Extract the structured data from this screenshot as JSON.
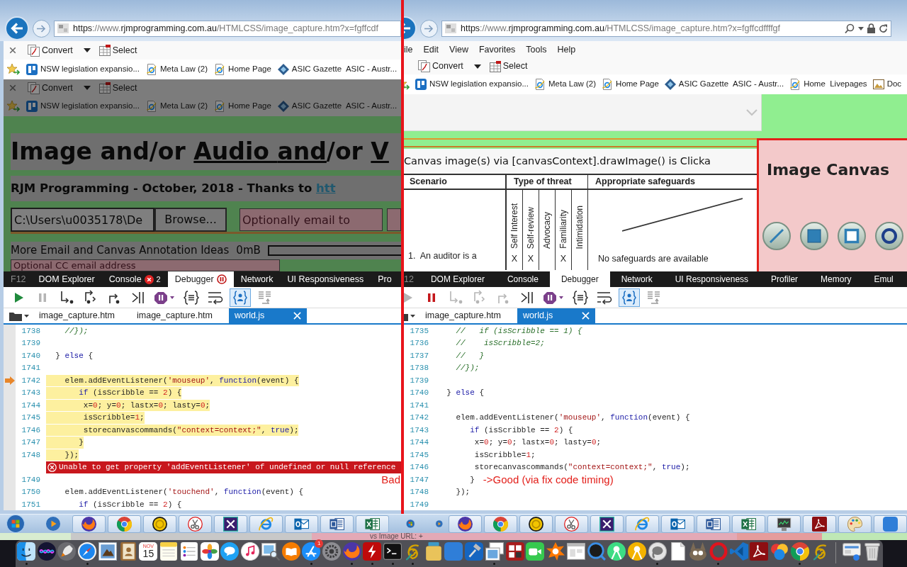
{
  "left_window": {
    "address_bar": {
      "url": [
        {
          "text": "https",
          "strong": true
        },
        {
          "text": "://www.",
          "strong": false
        },
        {
          "text": "rjmprogramming.com.au",
          "strong": true
        },
        {
          "text": "/HTMLCSS/image_capture.htm?x=fgffcdf",
          "strong": false
        }
      ]
    },
    "command_bar": {
      "items": [
        {
          "label": "Convert",
          "kind": "convert"
        },
        {
          "label": "Select",
          "kind": "select"
        }
      ]
    },
    "favorites": [
      {
        "label": "NSW legislation expansio...",
        "kind": "tile"
      },
      {
        "label": "Meta Law (2)",
        "kind": "page"
      },
      {
        "label": "Home Page",
        "kind": "page"
      },
      {
        "label": "ASIC Gazette  ASIC - Austr...",
        "kind": "diamond"
      }
    ],
    "page": {
      "dimmed": true,
      "command_bar": {
        "items": [
          {
            "label": "Convert",
            "kind": "convert"
          },
          {
            "label": "Select",
            "kind": "select"
          }
        ]
      },
      "favorites": [
        {
          "label": "NSW legislation expansio...",
          "kind": "tile"
        },
        {
          "label": "Meta Law (2)",
          "kind": "page"
        },
        {
          "label": "Home Page",
          "kind": "page"
        },
        {
          "label": "ASIC Gazette  ASIC - Austr...",
          "kind": "diamond"
        }
      ],
      "heading": [
        {
          "text": "Image and/or ",
          "link": false
        },
        {
          "text": "Audio ",
          "link": true
        },
        {
          "text": "and",
          "link": true
        },
        {
          "text": "/or ",
          "link": false
        },
        {
          "text": "V",
          "link": true
        }
      ],
      "subheading": [
        {
          "text": "RJM Programming - October, 2018 - Thanks to ",
          "link": false
        },
        {
          "text": "htt",
          "link": true
        }
      ],
      "file_field": {
        "value": "C:\\Users\\u0035178\\De"
      },
      "browse_button": "Browse...",
      "email_field": {
        "placeholder": "Optionally email to"
      },
      "ideas_label": "More Email and Canvas Annotation Ideas",
      "size_reading": "0mB",
      "cc_field": {
        "placeholder": "Optional CC email address"
      }
    },
    "devtools": {
      "f12_label": "F12",
      "tabs": [
        {
          "label": "DOM Explorer",
          "selected": false
        },
        {
          "label": "Console",
          "selected": false,
          "count": "2"
        },
        {
          "label": "Debugger",
          "selected": true,
          "paused": true
        },
        {
          "label": "Network",
          "selected": false
        },
        {
          "label": "UI Responsiveness",
          "selected": false
        },
        {
          "label": "Pro",
          "selected": false
        }
      ],
      "toolbar": {
        "paused": true,
        "just_my_code": true
      },
      "files": [
        {
          "label": "image_capture.htm",
          "selected": false
        },
        {
          "label": "image_capture.htm",
          "selected": false
        },
        {
          "label": "world.js",
          "selected": true
        }
      ],
      "lines": [
        {
          "kind": "code",
          "number": "1738",
          "highlighted": false,
          "current": false,
          "tokens": [
            {
              "text": "    //});",
              "kind": "comment"
            }
          ]
        },
        {
          "kind": "code",
          "number": "1739",
          "current": false
        },
        {
          "kind": "code",
          "number": "1740",
          "highlighted": false,
          "current": false,
          "tokens": [
            {
              "text": "  } ",
              "kind": "plain"
            },
            {
              "text": "else",
              "kind": "keyword"
            },
            {
              "text": " {",
              "kind": "plain"
            }
          ]
        },
        {
          "kind": "code",
          "number": "1741",
          "current": false
        },
        {
          "kind": "code",
          "number": "1742",
          "highlighted": true,
          "current": true,
          "tokens": [
            {
              "text": "    elem.addEventListener(",
              "kind": "plain"
            },
            {
              "text": "'mouseup'",
              "kind": "string"
            },
            {
              "text": ", ",
              "kind": "plain"
            },
            {
              "text": "function",
              "kind": "keyword"
            },
            {
              "text": "(event) {",
              "kind": "plain"
            }
          ]
        },
        {
          "kind": "code",
          "number": "1743",
          "highlighted": true,
          "current": false,
          "tokens": [
            {
              "text": "       if",
              "kind": "keyword"
            },
            {
              "text": " (isScribble == ",
              "kind": "plain"
            },
            {
              "text": "2",
              "kind": "number"
            },
            {
              "text": ") {",
              "kind": "plain"
            }
          ]
        },
        {
          "kind": "code",
          "number": "1744",
          "highlighted": true,
          "current": false,
          "tokens": [
            {
              "text": "        x=",
              "kind": "plain"
            },
            {
              "text": "0",
              "kind": "number"
            },
            {
              "text": "; y=",
              "kind": "plain"
            },
            {
              "text": "0",
              "kind": "number"
            },
            {
              "text": "; lastx=",
              "kind": "plain"
            },
            {
              "text": "0",
              "kind": "number"
            },
            {
              "text": "; lasty=",
              "kind": "plain"
            },
            {
              "text": "0",
              "kind": "number"
            },
            {
              "text": ";",
              "kind": "plain"
            }
          ]
        },
        {
          "kind": "code",
          "number": "1745",
          "highlighted": true,
          "current": false,
          "tokens": [
            {
              "text": "        isScribble=",
              "kind": "plain"
            },
            {
              "text": "1",
              "kind": "number"
            },
            {
              "text": ";",
              "kind": "plain"
            }
          ]
        },
        {
          "kind": "code",
          "number": "1746",
          "highlighted": true,
          "current": false,
          "tokens": [
            {
              "text": "        storecanvascommands(",
              "kind": "plain"
            },
            {
              "text": "\"context=context;\"",
              "kind": "string"
            },
            {
              "text": ", ",
              "kind": "plain"
            },
            {
              "text": "true",
              "kind": "keyword"
            },
            {
              "text": ");",
              "kind": "plain"
            }
          ]
        },
        {
          "kind": "code",
          "number": "1747",
          "highlighted": true,
          "current": false,
          "tokens": [
            {
              "text": "       }",
              "kind": "plain"
            }
          ]
        },
        {
          "kind": "code",
          "number": "1748",
          "highlighted": true,
          "current": false,
          "tokens": [
            {
              "text": "    });",
              "kind": "plain"
            }
          ]
        },
        {
          "kind": "error",
          "message": "Unable to get property 'addEventListener' of undefined or null reference"
        },
        {
          "kind": "code",
          "number": "1749",
          "current": false,
          "note": {
            "text": "Bad",
            "kind": "margin"
          }
        },
        {
          "kind": "code",
          "number": "1750",
          "highlighted": false,
          "current": false,
          "tokens": [
            {
              "text": "    elem.addEventListener(",
              "kind": "plain"
            },
            {
              "text": "'touchend'",
              "kind": "string"
            },
            {
              "text": ", ",
              "kind": "plain"
            },
            {
              "text": "function",
              "kind": "keyword"
            },
            {
              "text": "(event) {",
              "kind": "plain"
            }
          ]
        },
        {
          "kind": "code",
          "number": "1751",
          "highlighted": false,
          "current": false,
          "tokens": [
            {
              "text": "       if",
              "kind": "keyword"
            },
            {
              "text": " (isScribble == ",
              "kind": "plain"
            },
            {
              "text": "2",
              "kind": "number"
            },
            {
              "text": ") {",
              "kind": "plain"
            }
          ]
        }
      ]
    }
  },
  "right_window": {
    "address_bar": {
      "url": [
        {
          "text": "https",
          "strong": true
        },
        {
          "text": "://www.",
          "strong": false
        },
        {
          "text": "rjmprogramming.com.au",
          "strong": true
        },
        {
          "text": "/HTMLCSS/image_capture.htm?x=fgffcdffffgf",
          "strong": false
        }
      ]
    },
    "menu_bar": [
      "ile",
      "Edit",
      "View",
      "Favorites",
      "Tools",
      "Help"
    ],
    "command_bar": {
      "items": [
        {
          "label": "Convert",
          "kind": "convert"
        },
        {
          "label": "Select",
          "kind": "select"
        }
      ]
    },
    "favorites": [
      {
        "label": "NSW legislation expansio...",
        "kind": "tile"
      },
      {
        "label": "Meta Law (2)",
        "kind": "page"
      },
      {
        "label": "Home Page",
        "kind": "page"
      },
      {
        "label": "ASIC Gazette  ASIC - Austr...",
        "kind": "diamond"
      },
      {
        "label": "Home  Livepages",
        "kind": "page"
      },
      {
        "label": "Doc",
        "kind": "picture"
      }
    ],
    "page": {
      "canvas_caption": "Canvas image(s) via [canvasContext].drawImage() is Clicka",
      "threat_table": {
        "headings": [
          "Scenario",
          "Type of threat",
          "Appropriate safeguards"
        ],
        "threat_columns": [
          {
            "heading": "Self Interest",
            "mark": "X"
          },
          {
            "heading": "Self-review",
            "mark": "X"
          },
          {
            "heading": "Advocacy"
          },
          {
            "heading": "Familiarity",
            "mark": "X"
          },
          {
            "heading": "Intimidation"
          }
        ],
        "scenario": "1.  An auditor is a",
        "safeguards": "No safeguards are available"
      },
      "canvas_panel": {
        "title": "Image Canvas",
        "tools": [
          {
            "kind": "line"
          },
          {
            "kind": "filled_square"
          },
          {
            "kind": "square"
          },
          {
            "kind": "circle"
          }
        ]
      }
    },
    "devtools": {
      "f12_label": "12",
      "tabs": [
        {
          "label": "DOM Explorer",
          "selected": false
        },
        {
          "label": "Console",
          "selected": false
        },
        {
          "label": "Debugger",
          "selected": true,
          "paused": false
        },
        {
          "label": "Network",
          "selected": false
        },
        {
          "label": "UI Responsiveness",
          "selected": false
        },
        {
          "label": "Profiler",
          "selected": false
        },
        {
          "label": "Memory",
          "selected": false
        },
        {
          "label": "Emul",
          "selected": false
        }
      ],
      "toolbar": {
        "paused": false,
        "just_my_code": true
      },
      "files": [
        {
          "label": "image_capture.htm",
          "selected": false
        },
        {
          "label": "world.js",
          "selected": true
        }
      ],
      "lines": [
        {
          "kind": "code",
          "number": "1735",
          "tokens": [
            {
              "text": "    //   if (isScribble == 1) {",
              "kind": "comment"
            }
          ]
        },
        {
          "kind": "code",
          "number": "1736",
          "tokens": [
            {
              "text": "    //    isScribble=2;",
              "kind": "comment"
            }
          ]
        },
        {
          "kind": "code",
          "number": "1737",
          "tokens": [
            {
              "text": "    //   }",
              "kind": "comment"
            }
          ]
        },
        {
          "kind": "code",
          "number": "1738",
          "tokens": [
            {
              "text": "    //});",
              "kind": "comment"
            }
          ]
        },
        {
          "kind": "code",
          "number": "1739"
        },
        {
          "kind": "code",
          "number": "1740",
          "tokens": [
            {
              "text": "  } ",
              "kind": "plain"
            },
            {
              "text": "else",
              "kind": "keyword"
            },
            {
              "text": " {",
              "kind": "plain"
            }
          ]
        },
        {
          "kind": "code",
          "number": "1741"
        },
        {
          "kind": "code",
          "number": "1742",
          "tokens": [
            {
              "text": "    elem.addEventListener(",
              "kind": "plain"
            },
            {
              "text": "'mouseup'",
              "kind": "string"
            },
            {
              "text": ", ",
              "kind": "plain"
            },
            {
              "text": "function",
              "kind": "keyword"
            },
            {
              "text": "(event) {",
              "kind": "plain"
            }
          ]
        },
        {
          "kind": "code",
          "number": "1743",
          "tokens": [
            {
              "text": "       if",
              "kind": "keyword"
            },
            {
              "text": " (isScribble == ",
              "kind": "plain"
            },
            {
              "text": "2",
              "kind": "number"
            },
            {
              "text": ") {",
              "kind": "plain"
            }
          ]
        },
        {
          "kind": "code",
          "number": "1744",
          "tokens": [
            {
              "text": "        x=",
              "kind": "plain"
            },
            {
              "text": "0",
              "kind": "number"
            },
            {
              "text": "; y=",
              "kind": "plain"
            },
            {
              "text": "0",
              "kind": "number"
            },
            {
              "text": "; lastx=",
              "kind": "plain"
            },
            {
              "text": "0",
              "kind": "number"
            },
            {
              "text": "; lasty=",
              "kind": "plain"
            },
            {
              "text": "0",
              "kind": "number"
            },
            {
              "text": ";",
              "kind": "plain"
            }
          ]
        },
        {
          "kind": "code",
          "number": "1745",
          "tokens": [
            {
              "text": "        isScribble=",
              "kind": "plain"
            },
            {
              "text": "1",
              "kind": "number"
            },
            {
              "text": ";",
              "kind": "plain"
            }
          ]
        },
        {
          "kind": "code",
          "number": "1746",
          "tokens": [
            {
              "text": "        storecanvascommands(",
              "kind": "plain"
            },
            {
              "text": "\"context=context;\"",
              "kind": "string"
            },
            {
              "text": ", ",
              "kind": "plain"
            },
            {
              "text": "true",
              "kind": "keyword"
            },
            {
              "text": ");",
              "kind": "plain"
            }
          ]
        },
        {
          "kind": "code",
          "number": "1747",
          "tokens": [
            {
              "text": "       }",
              "kind": "plain"
            }
          ],
          "note": {
            "text": "->Good (via fix code timing)",
            "kind": "inline"
          }
        },
        {
          "kind": "code",
          "number": "1748",
          "tokens": [
            {
              "text": "    });",
              "kind": "plain"
            }
          ]
        },
        {
          "kind": "code",
          "number": "1749"
        }
      ]
    }
  },
  "background_strip": {
    "text": "vs Image URL: +"
  },
  "dock": {
    "calendar_month": "NOV",
    "calendar_day": "15",
    "badge": "1",
    "items": [
      {
        "running": true
      },
      {
        "running": false
      },
      {
        "running": false
      },
      {
        "running": true
      },
      {
        "running": false
      },
      {
        "running": false
      },
      {
        "running": false
      },
      {
        "running": false
      },
      {
        "running": false
      },
      {
        "running": false
      },
      {
        "running": false
      },
      {
        "running": false
      },
      {
        "running": false
      },
      {
        "running": false
      },
      {
        "running": true
      },
      {
        "running": false
      },
      {
        "running": true
      },
      {
        "running": true
      },
      {
        "running": true
      },
      {
        "running": true
      },
      {
        "running": false
      },
      {
        "running": false
      },
      {
        "running": false
      },
      {
        "running": true
      },
      {
        "running": false
      },
      {
        "running": false
      },
      {
        "running": false
      },
      {
        "running": false
      },
      {
        "running": false
      },
      {
        "running": false
      },
      {
        "running": false
      },
      {
        "running": true
      },
      {
        "running": false
      },
      {
        "running": false
      },
      {
        "running": true
      },
      {
        "running": false
      },
      {
        "running": false
      },
      {
        "running": false
      },
      {
        "running": true
      },
      {
        "running": false
      },
      {
        "running": false
      },
      {
        "running": false
      }
    ]
  }
}
